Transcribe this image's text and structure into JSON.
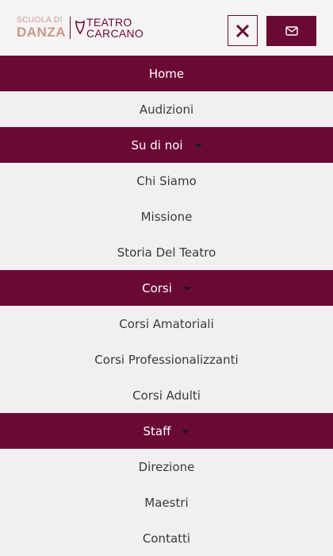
{
  "logo": {
    "danza_line1": "SCUOLA DI",
    "danza_line2": "DANZA",
    "carcano_line1": "TEATRO",
    "carcano_line2": "CARCANO"
  },
  "header": {
    "close_icon": "close-icon",
    "mail_icon": "mail-icon"
  },
  "colors": {
    "brand": "#6a0a34",
    "background": "#f2eff2",
    "logo_accent": "#c79a87"
  },
  "menu": {
    "items": [
      {
        "label": "Home",
        "active": true,
        "dropdown": false
      },
      {
        "label": "Audizioni",
        "active": false,
        "dropdown": false
      },
      {
        "label": "Su di noi",
        "active": true,
        "dropdown": true
      },
      {
        "label": "Chi Siamo",
        "active": false,
        "dropdown": false
      },
      {
        "label": "Missione",
        "active": false,
        "dropdown": false
      },
      {
        "label": "Storia Del Teatro",
        "active": false,
        "dropdown": false
      },
      {
        "label": "Corsi",
        "active": true,
        "dropdown": true
      },
      {
        "label": "Corsi Amatoriali",
        "active": false,
        "dropdown": false
      },
      {
        "label": "Corsi Professionalizzanti",
        "active": false,
        "dropdown": false
      },
      {
        "label": "Corsi Adulti",
        "active": false,
        "dropdown": false
      },
      {
        "label": "Staff",
        "active": true,
        "dropdown": true
      },
      {
        "label": "Direzione",
        "active": false,
        "dropdown": false
      },
      {
        "label": "Maestri",
        "active": false,
        "dropdown": false
      },
      {
        "label": "Contatti",
        "active": false,
        "dropdown": false
      }
    ]
  }
}
